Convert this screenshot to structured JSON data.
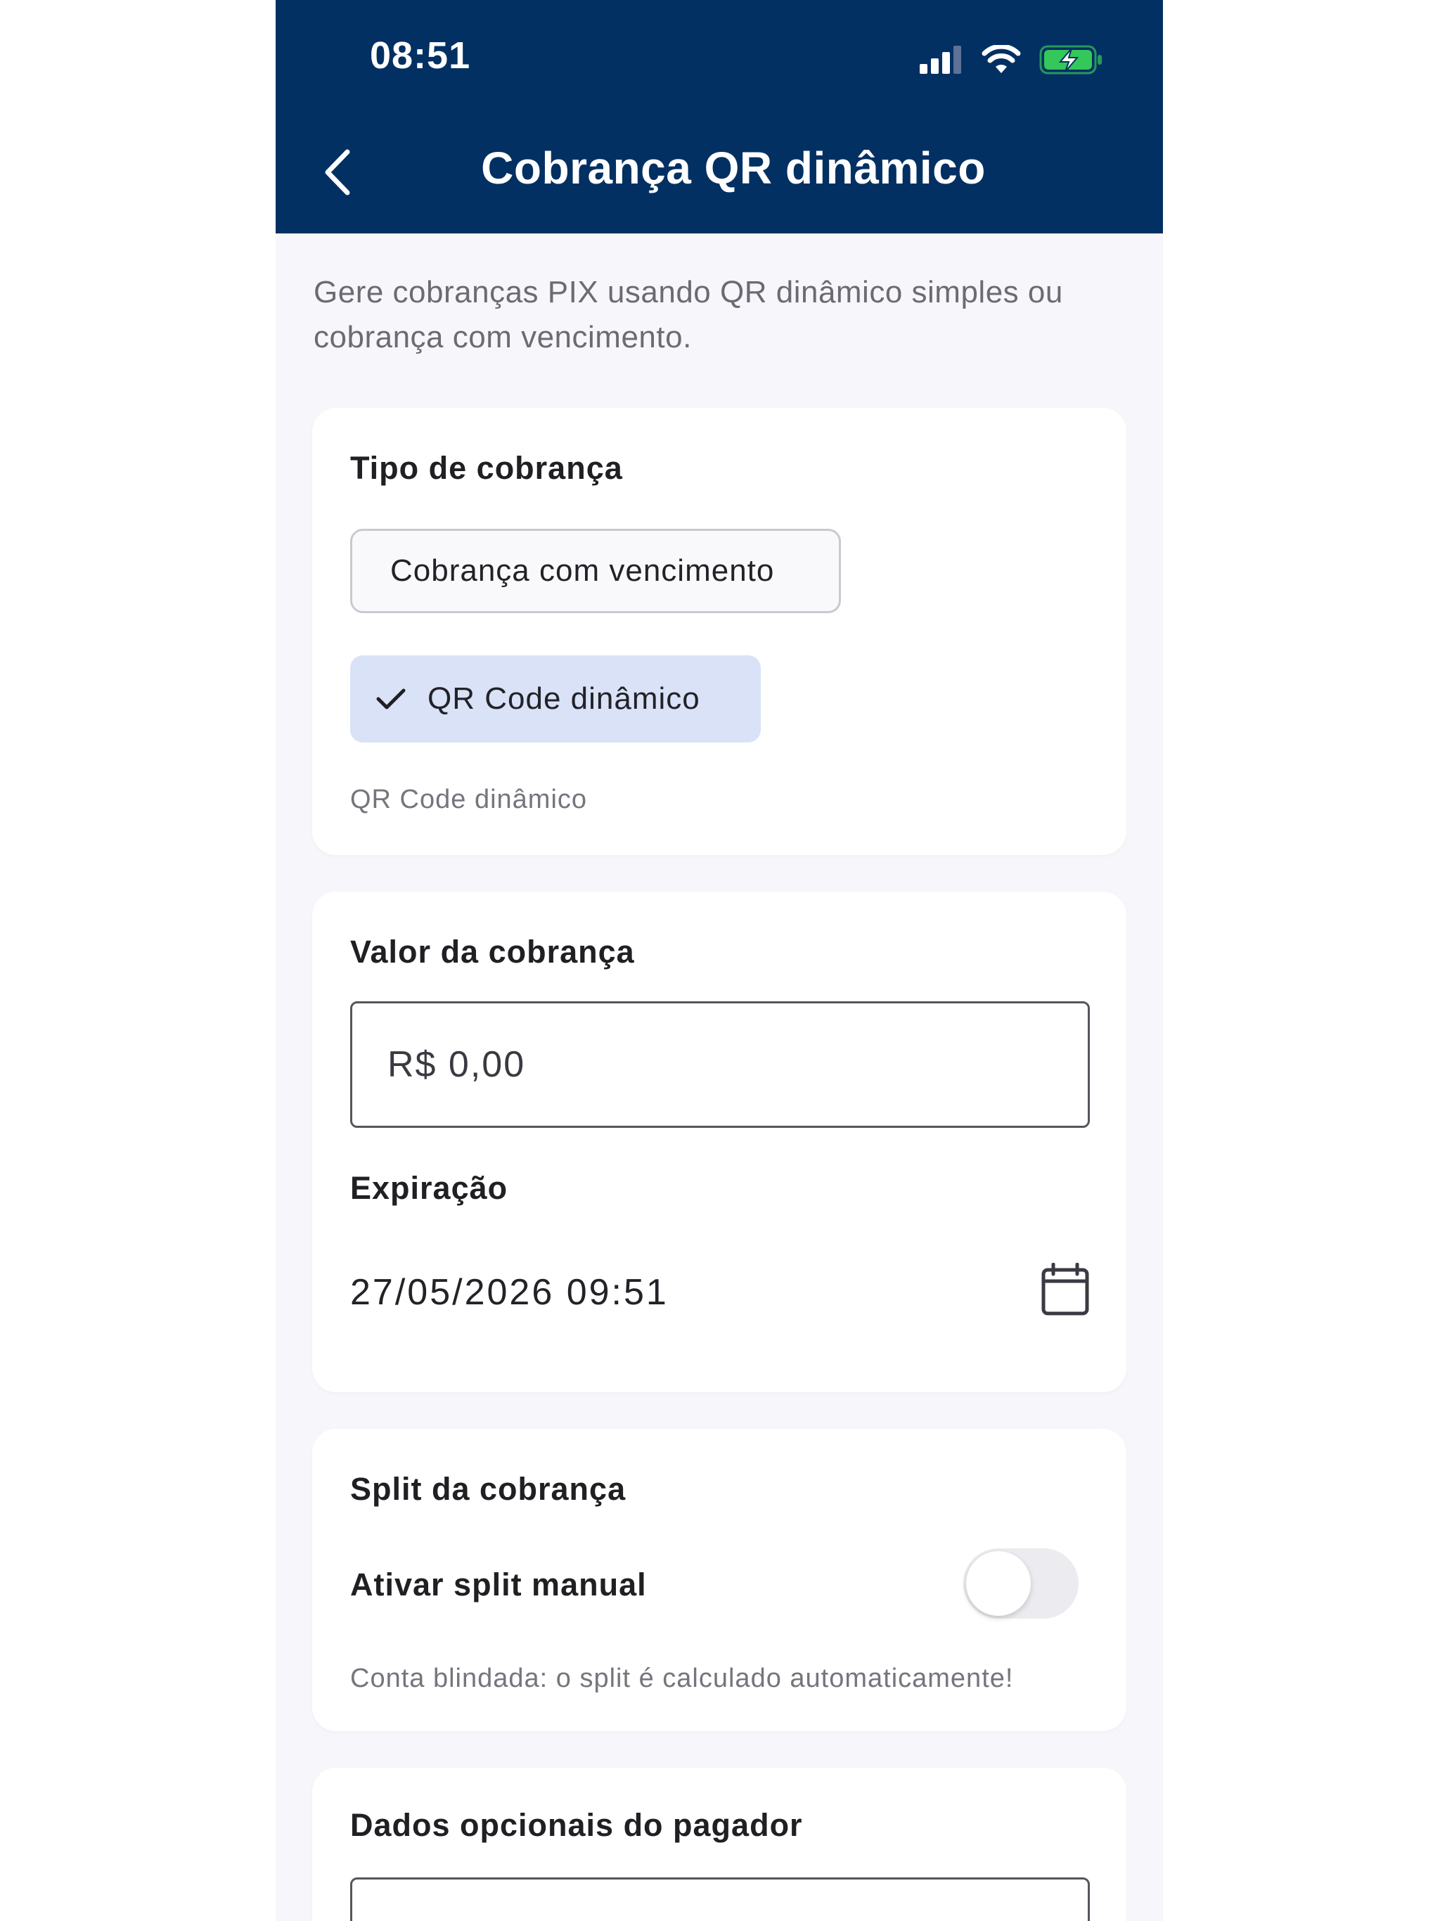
{
  "status_bar": {
    "time": "08:51"
  },
  "header": {
    "title": "Cobrança QR dinâmico"
  },
  "intro": "Gere cobranças PIX usando QR dinâmico simples ou cobrança com vencimento.",
  "charge_type_card": {
    "title": "Tipo de cobrança",
    "options": [
      "Cobrança com vencimento",
      "QR Code dinâmico"
    ],
    "selected": "QR Code dinâmico",
    "hint": "QR Code dinâmico"
  },
  "value_card": {
    "title": "Valor da cobrança",
    "amount_value": "R$ 0,00",
    "expiration_label": "Expiração",
    "expiration_value": "27/05/2026 09:51"
  },
  "split_card": {
    "title": "Split da cobrança",
    "toggle_label": "Ativar split manual",
    "toggle_on": false,
    "hint": "Conta blindada: o split é calculado automaticamente!"
  },
  "payer_card": {
    "title": "Dados opcionais do pagador",
    "field_value": ""
  },
  "colors": {
    "header": "#033063",
    "selected_chip": "#d9e2f7",
    "battery": "#34c759"
  }
}
